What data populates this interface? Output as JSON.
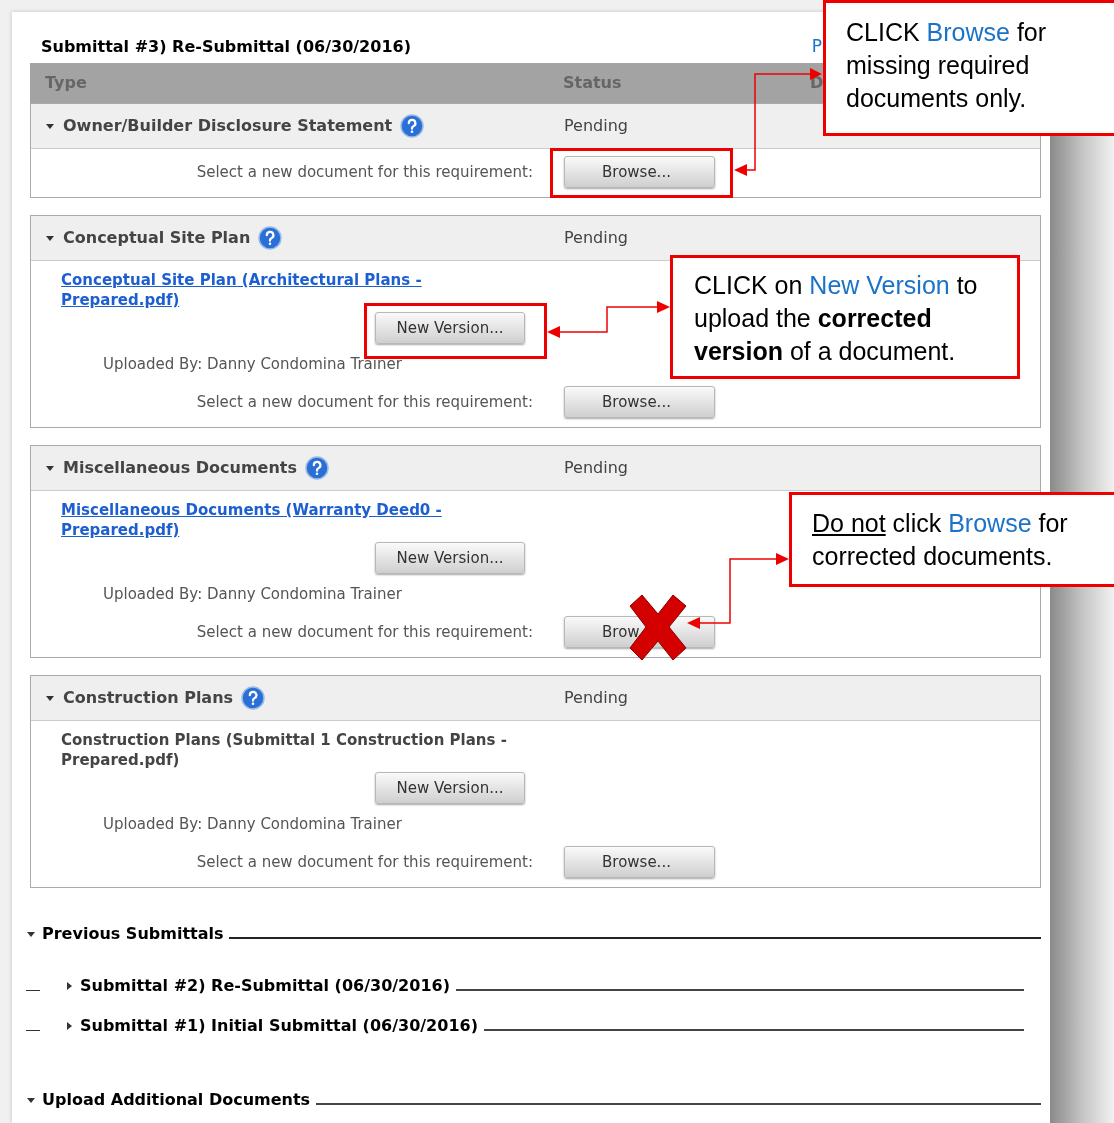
{
  "submittal_title": "Submittal #3) Re-Submittal (06/30/2016)",
  "header_link": "P",
  "table": {
    "columns": [
      "Type",
      "Status",
      "D"
    ]
  },
  "requirements": [
    {
      "type": "Owner/Builder Disclosure Statement",
      "status": "Pending",
      "expanded": true,
      "select_label": "Select a new document for this requirement:",
      "browse": "Browse..."
    },
    {
      "type": "Conceptual Site Plan",
      "status": "Pending",
      "expanded": true,
      "document": {
        "name": "Conceptual Site Plan (Architectural Plans - Prepared.pdf)",
        "kind": "link"
      },
      "new_version": "New Version...",
      "uploaded_by": "Uploaded By: Danny Condomina Trainer",
      "select_label": "Select a new document for this requirement:",
      "browse": "Browse..."
    },
    {
      "type": "Miscellaneous Documents",
      "status": "Pending",
      "expanded": true,
      "document": {
        "name": "Miscellaneous Documents (Warranty Deed0 - Prepared.pdf)",
        "kind": "link"
      },
      "new_version": "New Version...",
      "uploaded_by": "Uploaded By: Danny Condomina Trainer",
      "select_label": "Select a new document for this requirement:",
      "browse": "Brow"
    },
    {
      "type": "Construction Plans",
      "status": "Pending",
      "expanded": true,
      "document": {
        "name": "Construction Plans (Submittal 1 Construction Plans - Prepared.pdf)",
        "kind": "plain"
      },
      "new_version": "New Version...",
      "uploaded_by": "Uploaded By: Danny Condomina Trainer",
      "select_label": "Select a new document for this requirement:",
      "browse": "Browse..."
    }
  ],
  "previous_submittals": {
    "title": "Previous Submittals",
    "expanded": true,
    "items": [
      {
        "title": "Submittal #2) Re-Submittal (06/30/2016)",
        "expanded": false
      },
      {
        "title": "Submittal #1) Initial Submittal (06/30/2016)",
        "expanded": false
      }
    ]
  },
  "upload_additional": {
    "title": "Upload Additional Documents",
    "expanded": true
  },
  "callouts": [
    {
      "parts": [
        {
          "text": "CLICK ",
          "kind": "plain"
        },
        {
          "text": "Browse",
          "kind": "blue"
        },
        {
          "text": " for missing required documents only.",
          "kind": "plain"
        }
      ]
    },
    {
      "parts": [
        {
          "text": "CLICK on ",
          "kind": "plain"
        },
        {
          "text": "New Version",
          "kind": "blue"
        },
        {
          "text": " to upload the ",
          "kind": "plain"
        },
        {
          "text": "corrected version",
          "kind": "bold"
        },
        {
          "text": " of a document.",
          "kind": "plain"
        }
      ]
    },
    {
      "parts": [
        {
          "text": "Do not",
          "kind": "underline"
        },
        {
          "text": " click ",
          "kind": "plain"
        },
        {
          "text": "Browse",
          "kind": "blue"
        },
        {
          "text": " for corrected documents.",
          "kind": "plain"
        }
      ]
    }
  ]
}
